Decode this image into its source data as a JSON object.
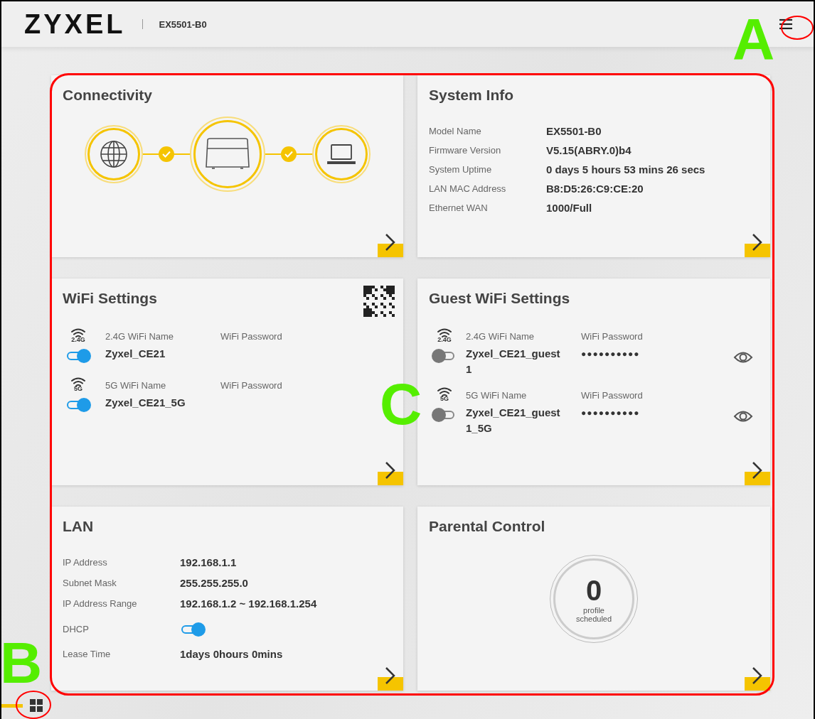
{
  "header": {
    "logo": "ZYXEL",
    "model": "EX5501-B0"
  },
  "connectivity": {
    "title": "Connectivity",
    "links": [
      {
        "ok": true
      },
      {
        "ok": true
      }
    ]
  },
  "system_info": {
    "title": "System Info",
    "rows": [
      {
        "label": "Model Name",
        "value": "EX5501-B0"
      },
      {
        "label": "Firmware Version",
        "value": "V5.15(ABRY.0)b4"
      },
      {
        "label": "System Uptime",
        "value": "0 days 5 hours 53 mins 26 secs"
      },
      {
        "label": "LAN MAC Address",
        "value": "B8:D5:26:C9:CE:20"
      },
      {
        "label": "Ethernet WAN",
        "value": "1000/Full"
      }
    ]
  },
  "wifi": {
    "title": "WiFi Settings",
    "networks": [
      {
        "band": "2.4G",
        "name_label": "2.4G WiFi Name",
        "password_label": "WiFi Password",
        "on": true,
        "name": "Zyxel_CE21"
      },
      {
        "band": "5G",
        "name_label": "5G WiFi Name",
        "password_label": "WiFi Password",
        "on": true,
        "name": "Zyxel_CE21_5G"
      }
    ]
  },
  "guest_wifi": {
    "title": "Guest WiFi Settings",
    "networks": [
      {
        "band": "2.4G",
        "name_label": "2.4G WiFi Name",
        "password_label": "WiFi Password",
        "on": false,
        "name": "Zyxel_CE21_guest1",
        "password": "●●●●●●●●●●"
      },
      {
        "band": "5G",
        "name_label": "5G WiFi Name",
        "password_label": "WiFi Password",
        "on": false,
        "name": "Zyxel_CE21_guest1_5G",
        "password": "●●●●●●●●●●"
      }
    ]
  },
  "lan": {
    "title": "LAN",
    "rows": [
      {
        "kind": "text",
        "label": "IP Address",
        "value": "192.168.1.1"
      },
      {
        "kind": "text",
        "label": "Subnet Mask",
        "value": "255.255.255.0"
      },
      {
        "kind": "text",
        "label": "IP Address Range",
        "value": "192.168.1.2 ~ 192.168.1.254"
      },
      {
        "kind": "toggle",
        "label": "DHCP",
        "on": true
      },
      {
        "kind": "text",
        "label": "Lease Time",
        "value": "1days 0hours 0mins"
      }
    ]
  },
  "parental_control": {
    "title": "Parental Control",
    "count": "0",
    "caption": "profile scheduled"
  },
  "annotations": [
    {
      "label": "A"
    },
    {
      "label": "B"
    },
    {
      "label": "C"
    }
  ]
}
